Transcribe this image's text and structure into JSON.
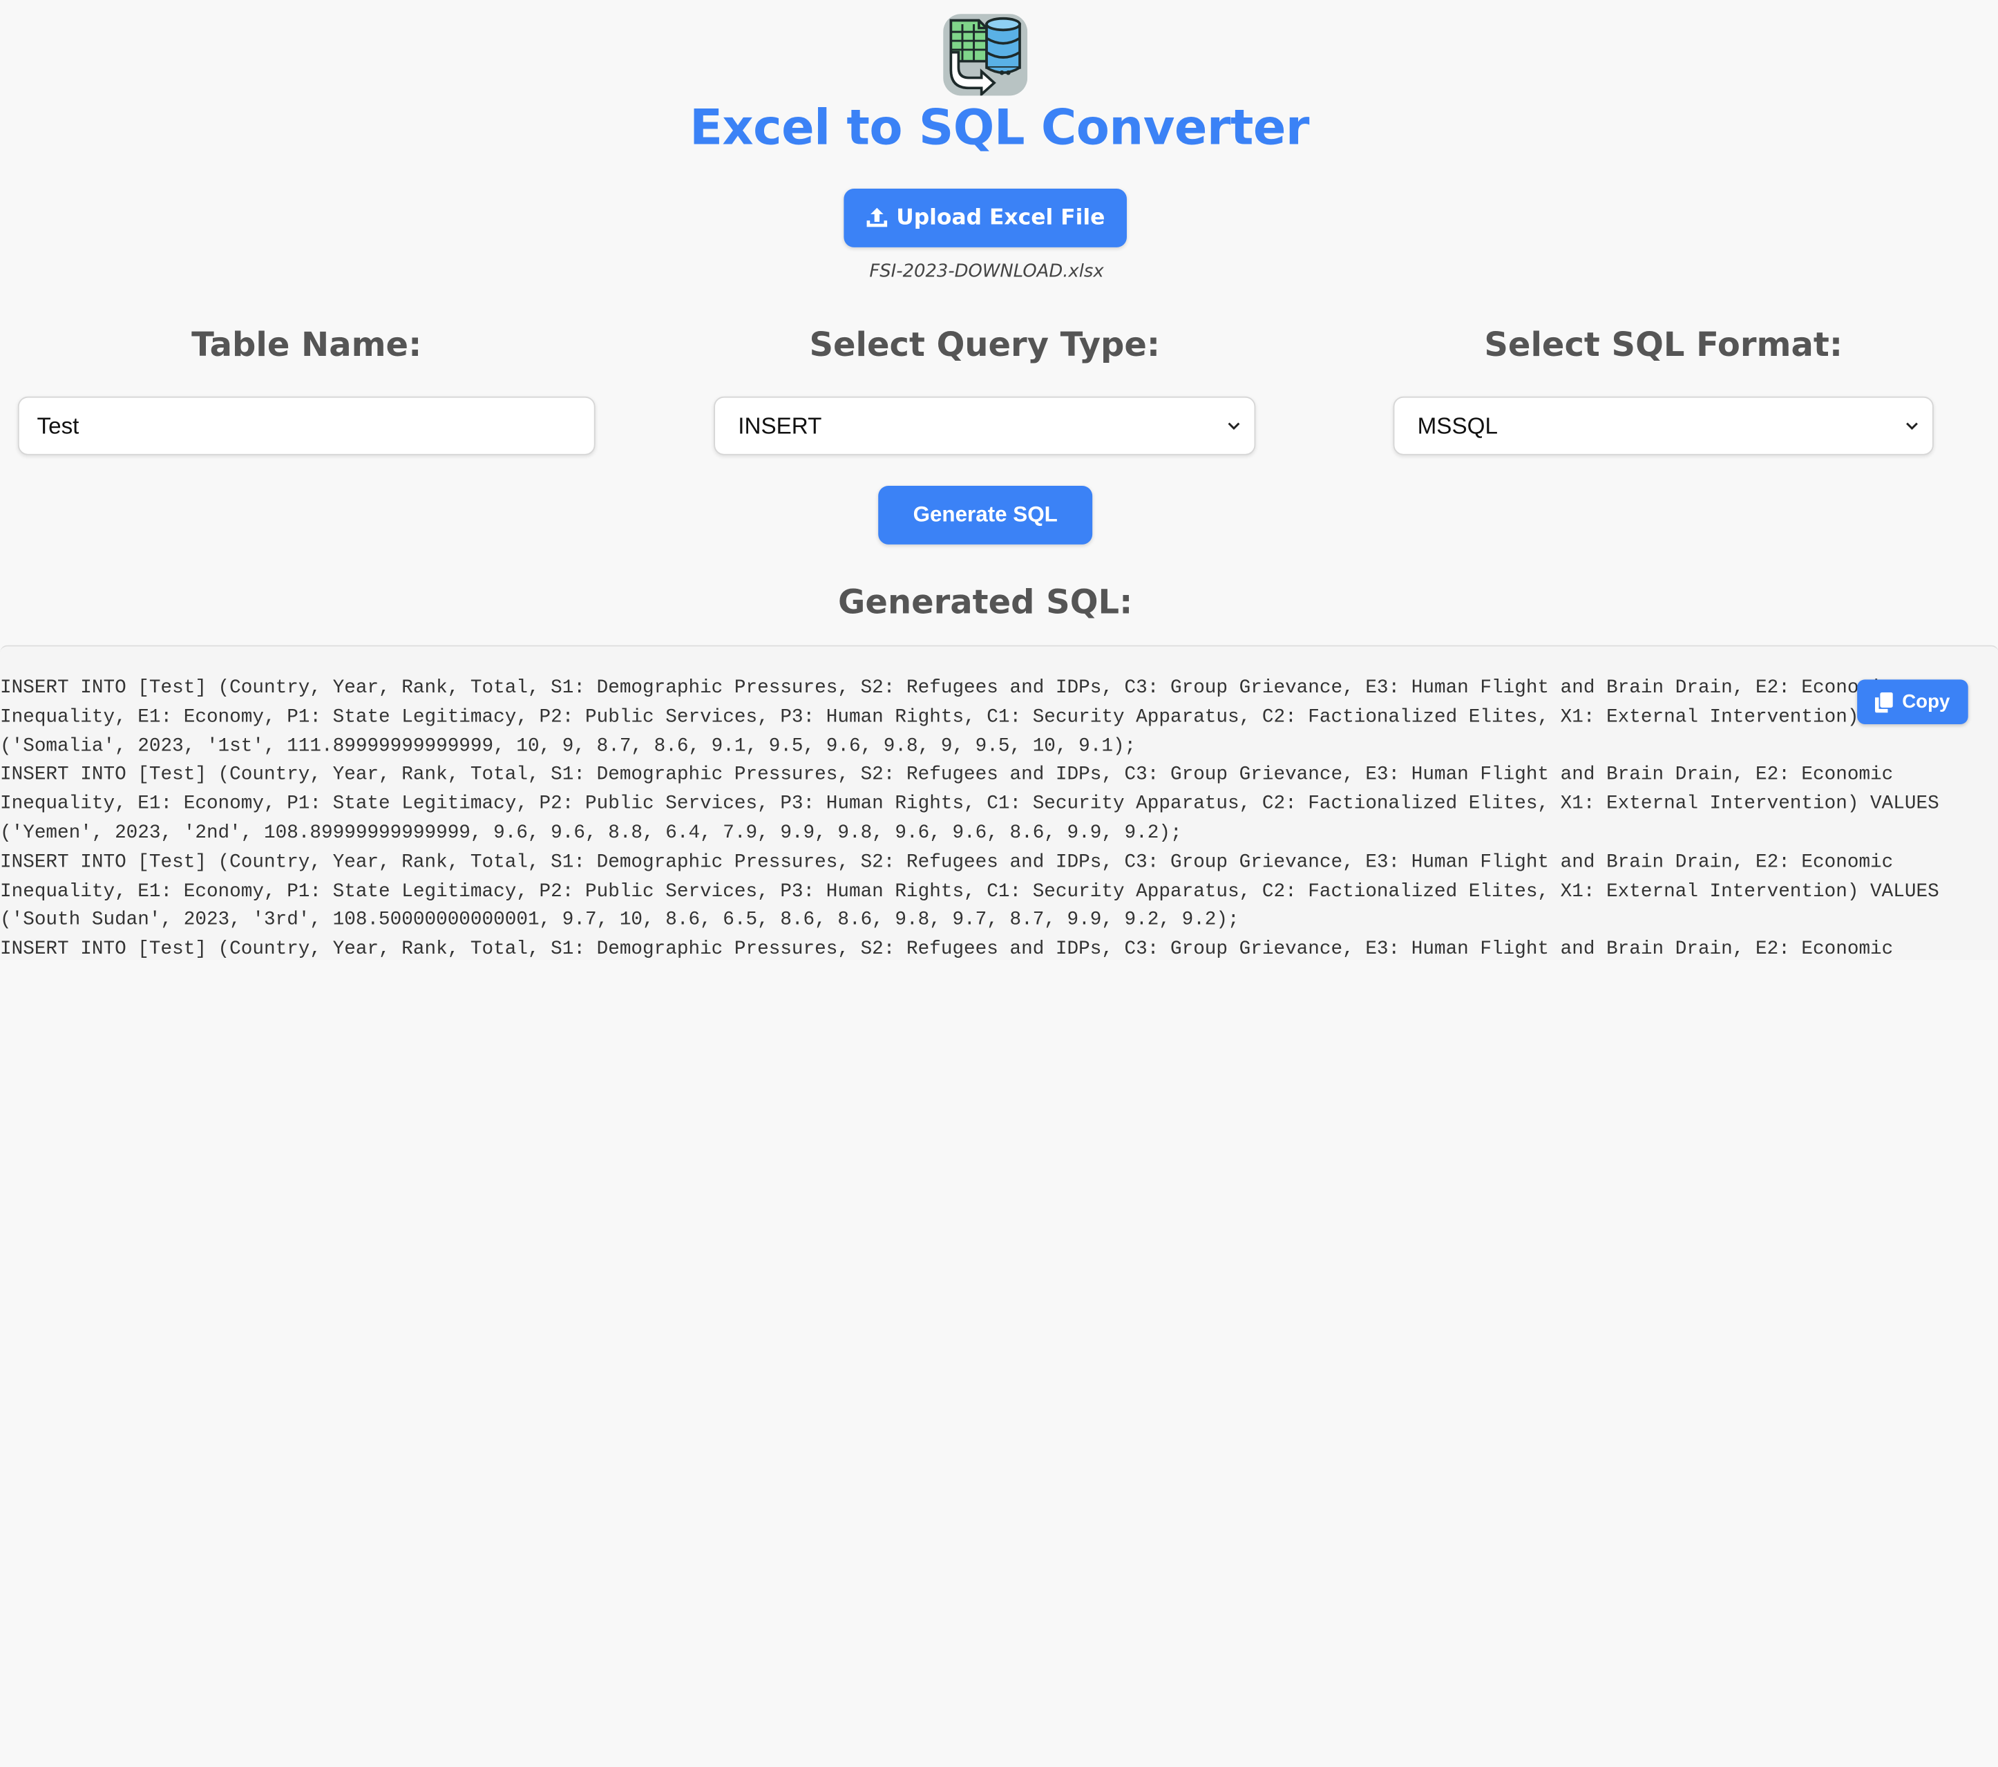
{
  "app": {
    "title": "Excel to SQL Converter"
  },
  "upload": {
    "label": "Upload Excel File",
    "filename": "FSI-2023-DOWNLOAD.xlsx"
  },
  "table_name": {
    "label": "Table Name:",
    "value": "Test"
  },
  "query_type": {
    "label": "Select Query Type:",
    "selected": "INSERT"
  },
  "sql_format": {
    "label": "Select SQL Format:",
    "selected": "MSSQL"
  },
  "generate": {
    "label": "Generate SQL"
  },
  "output": {
    "title": "Generated SQL:",
    "copy_label": "Copy",
    "sql": "INSERT INTO [Test] (Country, Year, Rank, Total, S1: Demographic Pressures, S2: Refugees and IDPs, C3: Group Grievance, E3: Human Flight and Brain Drain, E2: Economic Inequality, E1: Economy, P1: State Legitimacy, P2: Public Services, P3: Human Rights, C1: Security Apparatus, C2: Factionalized Elites, X1: External Intervention) VALUES ('Somalia', 2023, '1st', 111.89999999999999, 10, 9, 8.7, 8.6, 9.1, 9.5, 9.6, 9.8, 9, 9.5, 10, 9.1);\nINSERT INTO [Test] (Country, Year, Rank, Total, S1: Demographic Pressures, S2: Refugees and IDPs, C3: Group Grievance, E3: Human Flight and Brain Drain, E2: Economic Inequality, E1: Economy, P1: State Legitimacy, P2: Public Services, P3: Human Rights, C1: Security Apparatus, C2: Factionalized Elites, X1: External Intervention) VALUES ('Yemen', 2023, '2nd', 108.89999999999999, 9.6, 9.6, 8.8, 6.4, 7.9, 9.9, 9.8, 9.6, 9.6, 8.6, 9.9, 9.2);\nINSERT INTO [Test] (Country, Year, Rank, Total, S1: Demographic Pressures, S2: Refugees and IDPs, C3: Group Grievance, E3: Human Flight and Brain Drain, E2: Economic Inequality, E1: Economy, P1: State Legitimacy, P2: Public Services, P3: Human Rights, C1: Security Apparatus, C2: Factionalized Elites, X1: External Intervention) VALUES ('South Sudan', 2023, '3rd', 108.50000000000001, 9.7, 10, 8.6, 6.5, 8.6, 8.6, 9.8, 9.7, 8.7, 9.9, 9.2, 9.2);\nINSERT INTO [Test] (Country, Year, Rank, Total, S1: Demographic Pressures, S2: Refugees and IDPs, C3: Group Grievance, E3: Human Flight and Brain Drain, E2: Economic"
  },
  "icons": {
    "logo": "excel-to-database-icon",
    "upload": "upload-icon",
    "select_arrow": "chevron-down-icon",
    "copy": "copy-icon"
  },
  "colors": {
    "accent": "#3b82f6",
    "heading": "#555555",
    "background": "#f8f8f8"
  }
}
